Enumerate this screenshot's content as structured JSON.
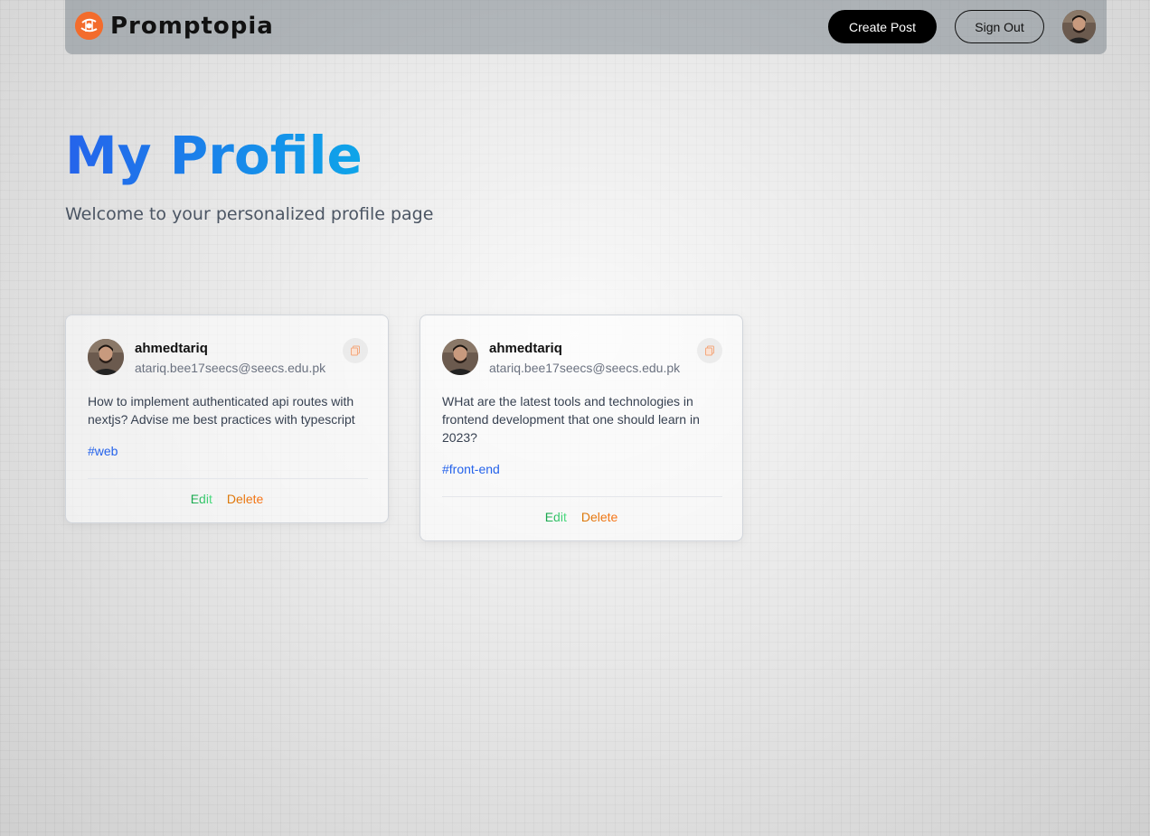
{
  "navbar": {
    "brand": "Promptopia",
    "create_post_label": "Create Post",
    "sign_out_label": "Sign Out",
    "logo_icon": "promptopia-logo-icon",
    "avatar_icon": "user-avatar"
  },
  "header": {
    "title": "My Profile",
    "subtitle": "Welcome to your personalized profile page"
  },
  "posts": [
    {
      "username": "ahmedtariq",
      "email": "atariq.bee17seecs@seecs.edu.pk",
      "prompt": "How to implement authenticated api routes with nextjs? Advise me best practices with typescript",
      "tag": "#web",
      "edit_label": "Edit",
      "delete_label": "Delete"
    },
    {
      "username": "ahmedtariq",
      "email": "atariq.bee17seecs@seecs.edu.pk",
      "prompt": "WHat are the latest tools and technologies in frontend development that one should learn in 2023?",
      "tag": "#front-end",
      "edit_label": "Edit",
      "delete_label": "Delete"
    }
  ],
  "colors": {
    "accent_blue": "#2563eb",
    "accent_cyan": "#0ea5e9",
    "logo_orange": "#f36c2c",
    "edit_green": "#22c55e",
    "delete_orange": "#f97316"
  }
}
